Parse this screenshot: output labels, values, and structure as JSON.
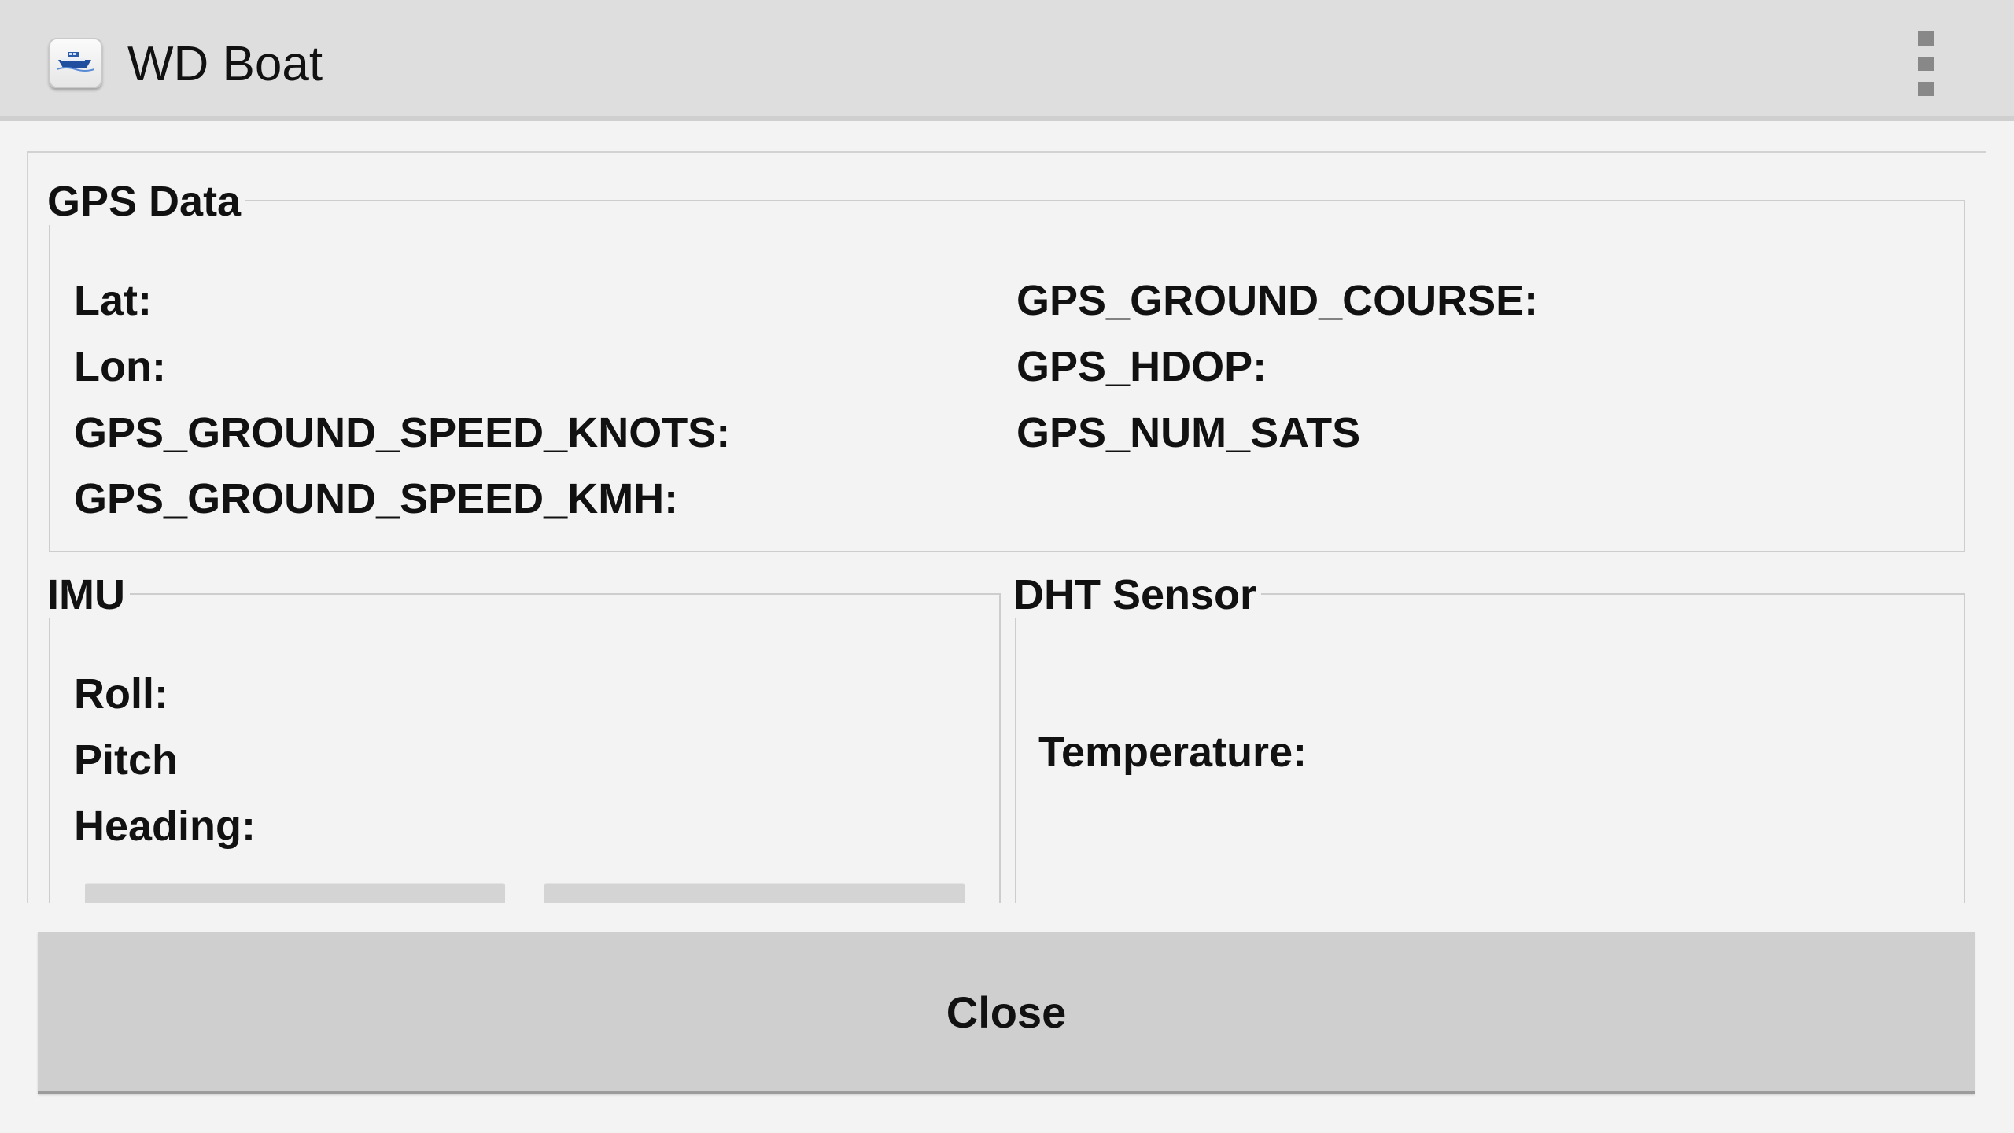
{
  "app_bar": {
    "title": "WD Boat",
    "icon": "boat-icon",
    "menu_icon": "overflow-menu-icon"
  },
  "gps": {
    "title": "GPS Data",
    "labels_left": [
      "Lat:",
      "Lon:",
      "GPS_GROUND_SPEED_KNOTS:",
      "GPS_GROUND_SPEED_KMH:"
    ],
    "labels_right": [
      "GPS_GROUND_COURSE:",
      "GPS_HDOP:",
      "GPS_NUM_SATS"
    ]
  },
  "imu": {
    "title": "IMU",
    "labels": [
      "Roll:",
      "Pitch",
      "Heading:"
    ]
  },
  "dht": {
    "title": "DHT Sensor",
    "temperature_label": "Temperature:"
  },
  "footer": {
    "close_label": "Close"
  },
  "colors": {
    "action_bar": "#dedede",
    "background": "#f3f3f3",
    "button": "#cfcfcf",
    "border": "#cdcdcd"
  }
}
